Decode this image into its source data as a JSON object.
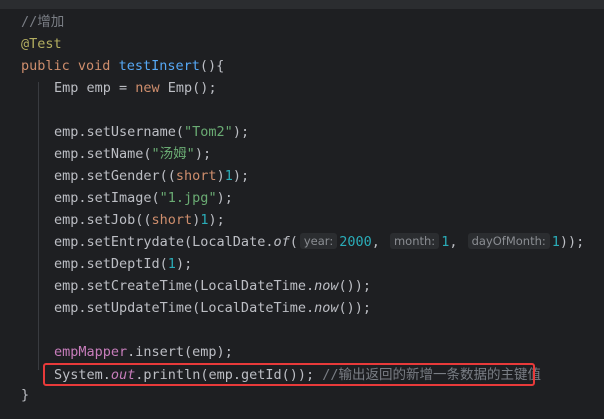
{
  "code": {
    "comment_add": "//增加",
    "annotation": "@Test",
    "kw_public": "public",
    "kw_void": "void",
    "method_name": "testInsert",
    "sig_tail": "(){",
    "emp_decl_a": "Emp emp = ",
    "kw_new": "new",
    "emp_decl_b": " Emp();",
    "set_username_a": "emp.setUsername(",
    "set_username_str": "\"Tom2\"",
    "set_username_b": ");",
    "set_name_a": "emp.setName(",
    "set_name_str": "\"汤姆\"",
    "set_name_b": ");",
    "set_gender_a": "emp.setGender((",
    "kw_short": "short",
    "cast_close": ")",
    "num_1": "1",
    "close_semi": ");",
    "set_image_a": "emp.setImage(",
    "set_image_str": "\"1.jpg\"",
    "set_image_b": ");",
    "set_job_a": "emp.setJob((",
    "set_entry_a": "emp.setEntrydate(LocalDate.",
    "method_of": "of",
    "paren_open": "(",
    "hint_year": "year:",
    "num_2000": "2000",
    "comma": ", ",
    "hint_month": "month:",
    "hint_day": "dayOfMonth:",
    "close_dbl": "));",
    "set_dept_a": "emp.setDeptId(",
    "set_create_a": "emp.setCreateTime(LocalDateTime.",
    "method_now": "now",
    "now_tail": "());",
    "set_update_a": "emp.setUpdateTime(LocalDateTime.",
    "mapper_field": "empMapper",
    "mapper_call": ".insert(emp);",
    "println_a": "System.",
    "field_out": "out",
    "println_b": ".println(emp.getId()); ",
    "println_comment": "//输出返回的新增一条数据的主键值",
    "closing_brace": "}"
  },
  "colors": {
    "keyword": "#cf8e6d",
    "method": "#56a8f5",
    "string": "#6aab73",
    "number": "#2aacb8",
    "comment": "#7a7e85",
    "annotation": "#b3ae60",
    "highlight_border": "#e83a3a"
  }
}
